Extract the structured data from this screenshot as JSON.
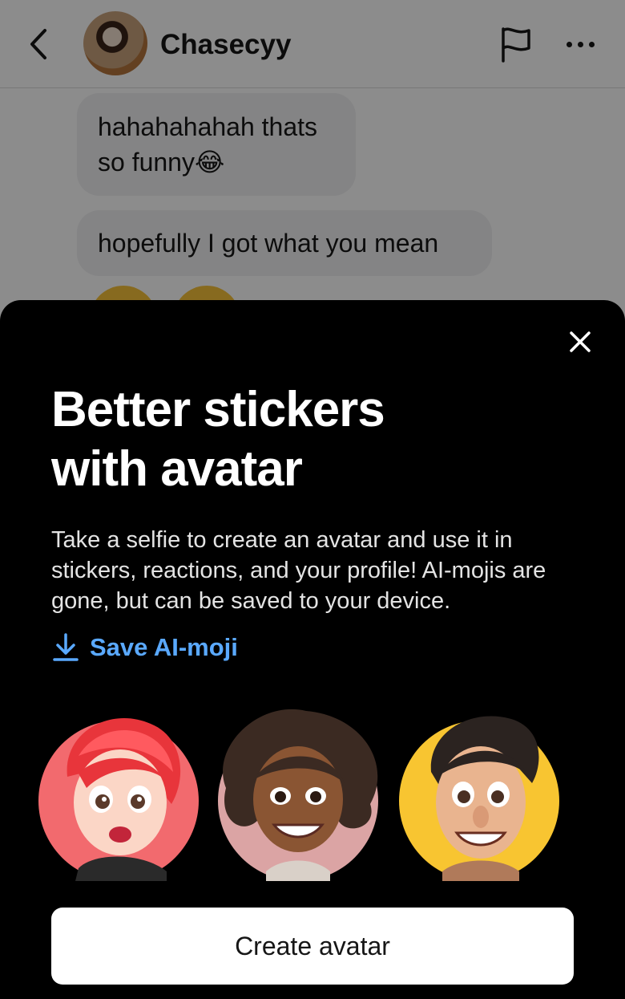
{
  "header": {
    "back_icon": "chevron-left-icon",
    "contact_name": "Chasecyy",
    "report_icon": "flag-icon",
    "more_icon": "more-horizontal-icon"
  },
  "messages": [
    {
      "text_line1": "hahahahahah thats",
      "text_line2": "so funny😂"
    },
    {
      "text": "hopefully I got what you mean"
    }
  ],
  "sheet": {
    "close_icon": "close-icon",
    "title_line1": "Better stickers",
    "title_line2": "with avatar",
    "description": "Take a selfie to create an avatar and use it in stickers, reactions, and your profile! AI-mojis are gone, but can be saved to your device.",
    "save_label": "Save AI-moji",
    "save_icon": "download-icon",
    "cta_label": "Create avatar",
    "colors": {
      "background": "#000000",
      "link": "#5aa9ff",
      "avatar_bg_1": "#f26a6e",
      "avatar_bg_2": "#dba4a4",
      "avatar_bg_3": "#f8c531"
    }
  }
}
